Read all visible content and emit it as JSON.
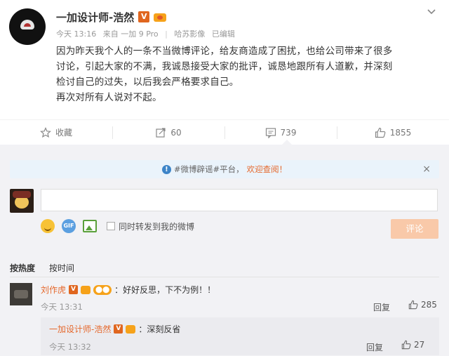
{
  "post": {
    "author": "一加设计师-浩然",
    "time": "今天 13:16",
    "source": "来自 一加 9 Pro",
    "group": "哈苏影像",
    "edited": "已编辑",
    "text_lines": [
      "因为昨天我个人的一条不当微博评论，给友商造成了困扰，也给公司带来了很多",
      "讨论，引起大家的不满，我诚恳接受大家的批评，诚恳地跟所有人道歉，并深刻",
      "检讨自己的过失，以后我会严格要求自己。",
      "再次对所有人说对不起。"
    ],
    "actions": {
      "favorite": "收藏",
      "repost": "60",
      "comment": "739",
      "like": "1855"
    }
  },
  "comment_panel": {
    "notice_prefix": "#微博辟谣#平台，",
    "notice_link": "欢迎查阅！",
    "close_symbol": "×",
    "repost_checkbox_label": "同时转发到我的微博",
    "submit_label": "评论",
    "sort_tabs": [
      "按热度",
      "按时间"
    ],
    "comments": [
      {
        "user": "刘作虎",
        "text": "：好好反思，下不为例！！",
        "time": "今天 13:31",
        "reply_label": "回复",
        "likes": "285",
        "replies": [
          {
            "user": "一加设计师-浩然",
            "text": "：深刻反省",
            "time": "今天 13:32",
            "reply_label": "回复",
            "likes": "27"
          }
        ]
      }
    ]
  },
  "colors": {
    "accent_orange": "#e5682c",
    "verified_badge": "#e0661f",
    "submit_disabled": "#f9c9a9",
    "notice_bg": "#eaf3fb",
    "panel_bg": "#f2f2f5"
  }
}
